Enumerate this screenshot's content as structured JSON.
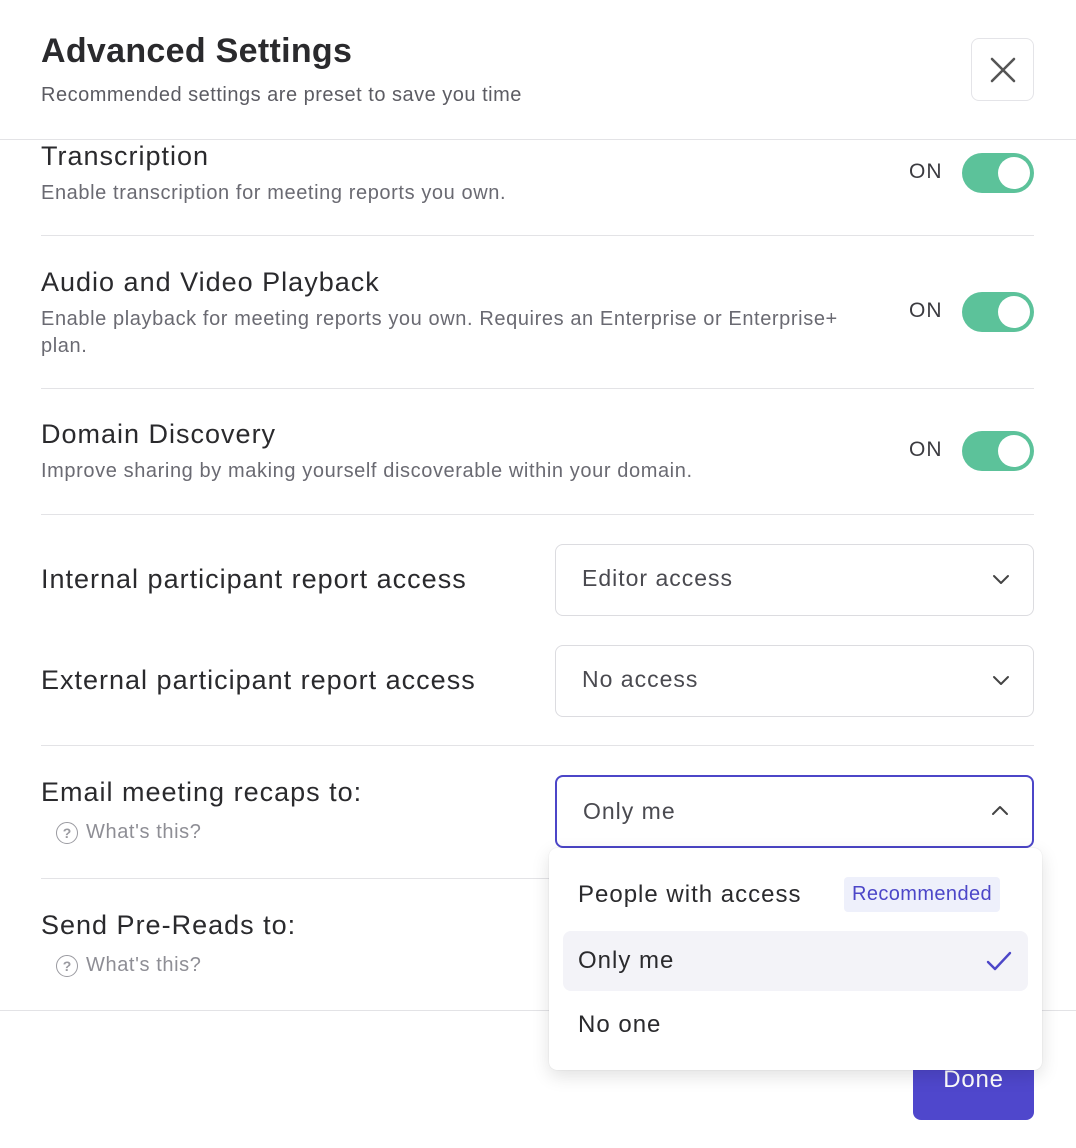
{
  "header": {
    "title": "Advanced Settings",
    "subtitle": "Recommended settings are preset to save you time"
  },
  "toggles": [
    {
      "title": "Transcription",
      "description": "Enable transcription for meeting reports you own.",
      "state_label": "ON",
      "on": true
    },
    {
      "title": "Audio and Video Playback",
      "description": "Enable playback for meeting reports you own. Requires an Enterprise or Enterprise+ plan.",
      "state_label": "ON",
      "on": true
    },
    {
      "title": "Domain Discovery",
      "description": "Improve sharing by making yourself discoverable within your domain.",
      "state_label": "ON",
      "on": true
    }
  ],
  "access": {
    "internal": {
      "label": "Internal participant report access",
      "value": "Editor access"
    },
    "external": {
      "label": "External participant report access",
      "value": "No access"
    }
  },
  "email_recaps": {
    "label": "Email meeting recaps to:",
    "help": "What's this?",
    "value": "Only me",
    "options": [
      {
        "label": "People with access",
        "badge": "Recommended"
      },
      {
        "label": "Only me",
        "selected": true
      },
      {
        "label": "No one"
      }
    ]
  },
  "pre_reads": {
    "label": "Send Pre-Reads to:",
    "help": "What's this?"
  },
  "footer": {
    "done_label": "Done"
  },
  "colors": {
    "accent": "#4f47cc",
    "toggle_on": "#5cc29a"
  }
}
